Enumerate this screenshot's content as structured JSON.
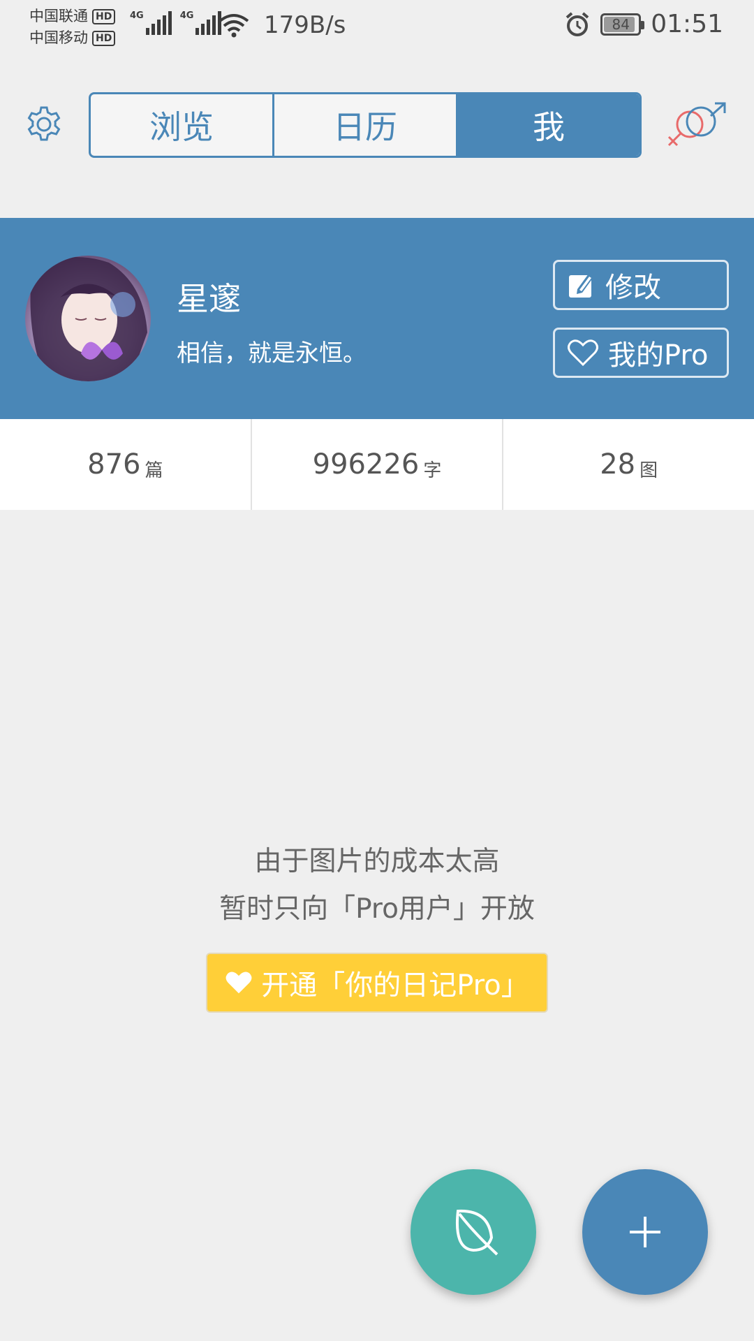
{
  "status_bar": {
    "carrier_1": "中国联通",
    "carrier_2": "中国移动",
    "hd_badge": "HD",
    "network_type": "4G",
    "net_speed": "179B/s",
    "battery_level": "84",
    "time": "01:51"
  },
  "nav": {
    "tabs": [
      {
        "label": "浏览",
        "active": false
      },
      {
        "label": "日历",
        "active": false
      },
      {
        "label": "我",
        "active": true
      }
    ]
  },
  "profile": {
    "name": "星邃",
    "motto": "相信，就是永恒。",
    "edit_label": "修改",
    "pro_label": "我的Pro"
  },
  "stats": [
    {
      "value": "876",
      "unit": "篇"
    },
    {
      "value": "996226",
      "unit": "字"
    },
    {
      "value": "28",
      "unit": "图"
    }
  ],
  "empty_state": {
    "line_1": "由于图片的成本太高",
    "line_2": "暂时只向「Pro用户」开放",
    "cta_label": "开通「你的日记Pro」"
  },
  "colors": {
    "primary": "#4a87b7",
    "teal": "#4cb5ab",
    "pro_yellow": "#ffcf38",
    "background": "#efefef",
    "female_symbol": "#e86a6a"
  },
  "icons": {
    "settings": "gear-icon",
    "gender": "gender-symbol-icon",
    "edit": "edit-icon",
    "pro": "heart-icon",
    "fab_left": "leaf-icon",
    "fab_right": "plus-icon"
  }
}
